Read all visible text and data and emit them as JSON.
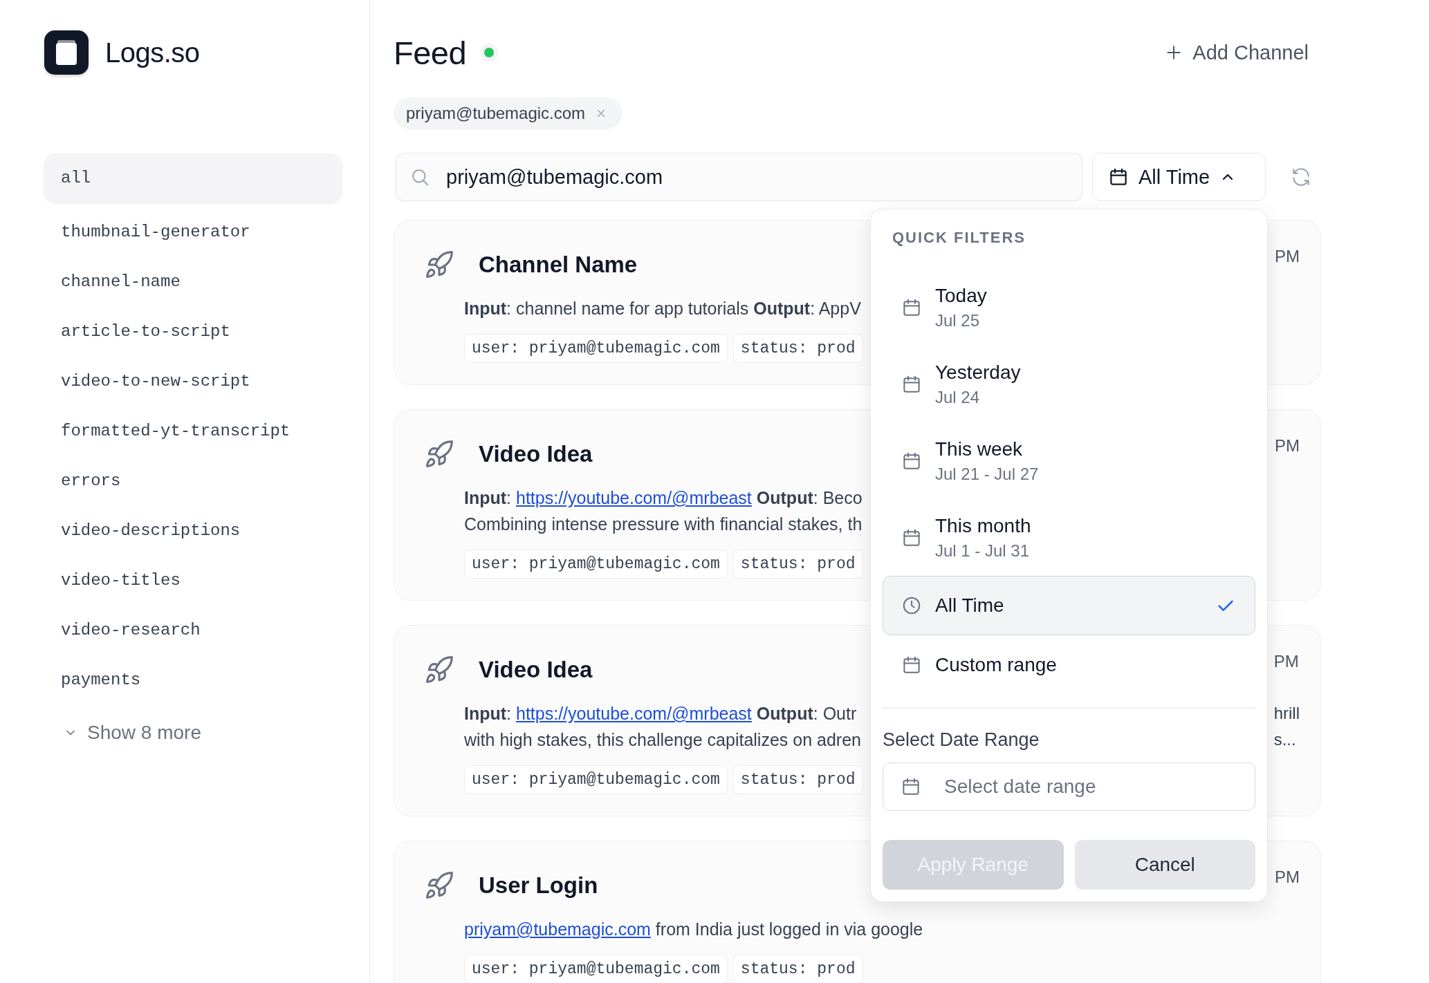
{
  "brand": {
    "name": "Logs.so"
  },
  "sidebar": {
    "items": [
      {
        "label": "all",
        "selected": true
      },
      {
        "label": "thumbnail-generator",
        "selected": false
      },
      {
        "label": "channel-name",
        "selected": false
      },
      {
        "label": "article-to-script",
        "selected": false
      },
      {
        "label": "video-to-new-script",
        "selected": false
      },
      {
        "label": "formatted-yt-transcript",
        "selected": false
      },
      {
        "label": "errors",
        "selected": false
      },
      {
        "label": "video-descriptions",
        "selected": false
      },
      {
        "label": "video-titles",
        "selected": false
      },
      {
        "label": "video-research",
        "selected": false
      },
      {
        "label": "payments",
        "selected": false
      }
    ],
    "show_more": "Show 8 more"
  },
  "header": {
    "title": "Feed",
    "live": true,
    "add_button": "Add Channel"
  },
  "filter_chips": [
    {
      "label": "priyam@tubemagic.com"
    }
  ],
  "search": {
    "value": "priyam@tubemagic.com"
  },
  "date_button": {
    "label": "All Time",
    "expanded": true
  },
  "cards": [
    {
      "title": "Channel Name",
      "time": "PM",
      "lines": [
        [
          {
            "kind": "bold",
            "text": "Input"
          },
          {
            "kind": "text",
            "text": ": channel name for app tutorials "
          },
          {
            "kind": "bold",
            "text": "Output"
          },
          {
            "kind": "text",
            "text": ": AppV"
          }
        ]
      ],
      "tags": [
        "user: priyam@tubemagic.com",
        "status: prod"
      ]
    },
    {
      "title": "Video Idea",
      "time": "PM",
      "lines": [
        [
          {
            "kind": "bold",
            "text": "Input"
          },
          {
            "kind": "text",
            "text": ": "
          },
          {
            "kind": "link",
            "text": "https://youtube.com/@mrbeast"
          },
          {
            "kind": "bold",
            "text": "Output"
          },
          {
            "kind": "text",
            "text": ": Beco"
          }
        ],
        [
          {
            "kind": "text",
            "text": "Combining intense pressure with financial stakes, th"
          }
        ]
      ],
      "tags": [
        "user: priyam@tubemagic.com",
        "status: prod"
      ]
    },
    {
      "title": "Video Idea",
      "time": "PM",
      "lines": [
        [
          {
            "kind": "bold",
            "text": "Input"
          },
          {
            "kind": "text",
            "text": ": "
          },
          {
            "kind": "link",
            "text": "https://youtube.com/@mrbeast"
          },
          {
            "kind": "bold",
            "text": "Output"
          },
          {
            "kind": "text",
            "text": ": Outr"
          }
        ],
        [
          {
            "kind": "text",
            "text": "with high stakes, this challenge capitalizes on adren"
          }
        ]
      ],
      "right_lines": [
        "hrill",
        "s..."
      ],
      "tags": [
        "user: priyam@tubemagic.com",
        "status: prod"
      ]
    },
    {
      "title": "User Login",
      "time": "PM",
      "lines": [
        [
          {
            "kind": "link",
            "text": "priyam@tubemagic.com"
          },
          {
            "kind": "text",
            "text": " from India just logged in via google"
          }
        ]
      ],
      "tags": [
        "user: priyam@tubemagic.com",
        "status: prod"
      ]
    }
  ],
  "date_menu": {
    "heading": "QUICK FILTERS",
    "options": [
      {
        "kind": "calendar",
        "label": "Today",
        "sub": "Jul 25",
        "selected": false
      },
      {
        "kind": "calendar",
        "label": "Yesterday",
        "sub": "Jul 24",
        "selected": false
      },
      {
        "kind": "calendar",
        "label": "This week",
        "sub": "Jul 21 - Jul 27",
        "selected": false
      },
      {
        "kind": "calendar",
        "label": "This month",
        "sub": "Jul 1 - Jul 31",
        "selected": false
      },
      {
        "kind": "clock",
        "label": "All Time",
        "selected": true
      },
      {
        "kind": "calendar",
        "label": "Custom range",
        "selected": false
      }
    ],
    "range_label": "Select Date Range",
    "range_placeholder": "Select date range",
    "apply": {
      "label": "Apply Range",
      "disabled": true
    },
    "cancel": {
      "label": "Cancel"
    }
  }
}
